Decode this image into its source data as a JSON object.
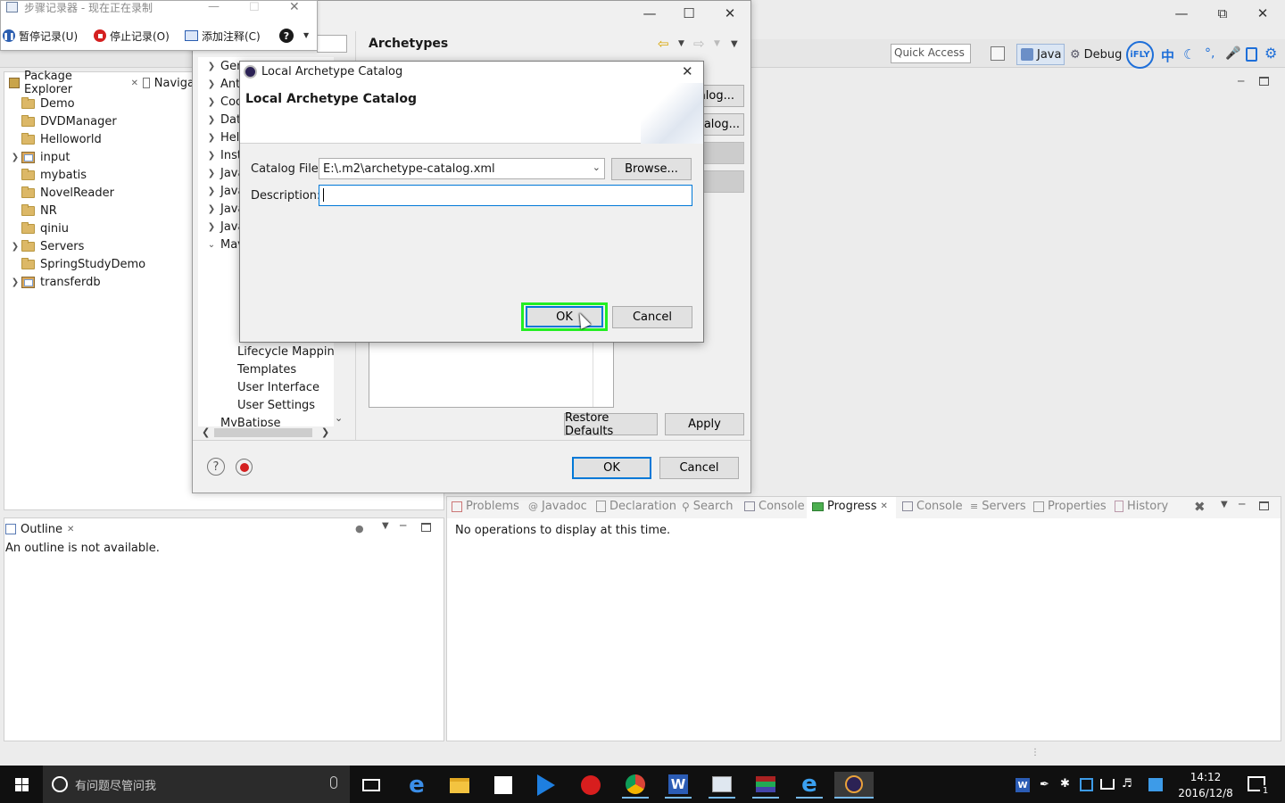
{
  "steps_recorder": {
    "title": "步骤记录器 - 现在正在录制",
    "pause_label": "暂停记录(U)",
    "stop_label": "停止记录(O)",
    "comment_label": "添加注释(C)"
  },
  "eclipse": {
    "quick_access_placeholder": "Quick Access",
    "perspective_java": "Java",
    "perspective_debug": "Debug",
    "ime_ifly": "iFLY",
    "ime_zh": "中"
  },
  "package_explorer": {
    "tab_label": "Package Explorer",
    "second_tab_label": "Naviga",
    "items": [
      {
        "label": "Demo",
        "type": "folder",
        "expandable": false
      },
      {
        "label": "DVDManager",
        "type": "folder",
        "expandable": false
      },
      {
        "label": "Helloworld",
        "type": "folder",
        "expandable": false
      },
      {
        "label": "input",
        "type": "project",
        "expandable": true
      },
      {
        "label": "mybatis",
        "type": "folder",
        "expandable": false
      },
      {
        "label": "NovelReader",
        "type": "folder",
        "expandable": false
      },
      {
        "label": "NR",
        "type": "folder",
        "expandable": false
      },
      {
        "label": "qiniu",
        "type": "folder",
        "expandable": false
      },
      {
        "label": "Servers",
        "type": "folder-open",
        "expandable": true
      },
      {
        "label": "SpringStudyDemo",
        "type": "folder",
        "expandable": false
      },
      {
        "label": "transferdb",
        "type": "project",
        "expandable": true
      }
    ]
  },
  "outline": {
    "tab_label": "Outline",
    "message": "An outline is not available."
  },
  "bottom_tabs": {
    "tabs": [
      "Problems",
      "Javadoc",
      "Declaration",
      "Search",
      "Console",
      "Progress",
      "Console",
      "Servers",
      "Properties",
      "History"
    ],
    "active_tab": "Progress",
    "message": "No operations to display at this time."
  },
  "preferences": {
    "section_title": "Archetypes",
    "tree_items": [
      "Gen",
      "Ant",
      "Coc",
      "Dat",
      "Hel",
      "Inst",
      "Java",
      "Java",
      "Java",
      "Java",
      "Mav"
    ],
    "maven_children": [
      "Lifecycle Mapping",
      "Templates",
      "User Interface",
      "User Settings"
    ],
    "tree_last": "MyBatipse",
    "right_btn_1": "alog...",
    "right_btn_2": "talog...",
    "restore_defaults": "Restore Defaults",
    "apply": "Apply",
    "ok": "OK",
    "cancel": "Cancel"
  },
  "dialog": {
    "window_title": "Local Archetype Catalog",
    "heading": "Local Archetype Catalog",
    "catalog_file_label": "Catalog File:",
    "catalog_file_value": "E:\\.m2\\archetype-catalog.xml",
    "browse_label": "Browse...",
    "description_label": "Description:",
    "description_value": "",
    "ok_label": "OK",
    "cancel_label": "Cancel",
    "highlight_color": "#22ee22"
  },
  "taskbar": {
    "search_placeholder": "有问题尽管问我",
    "time": "14:12",
    "date": "2016/12/8",
    "notification_count": "1"
  }
}
